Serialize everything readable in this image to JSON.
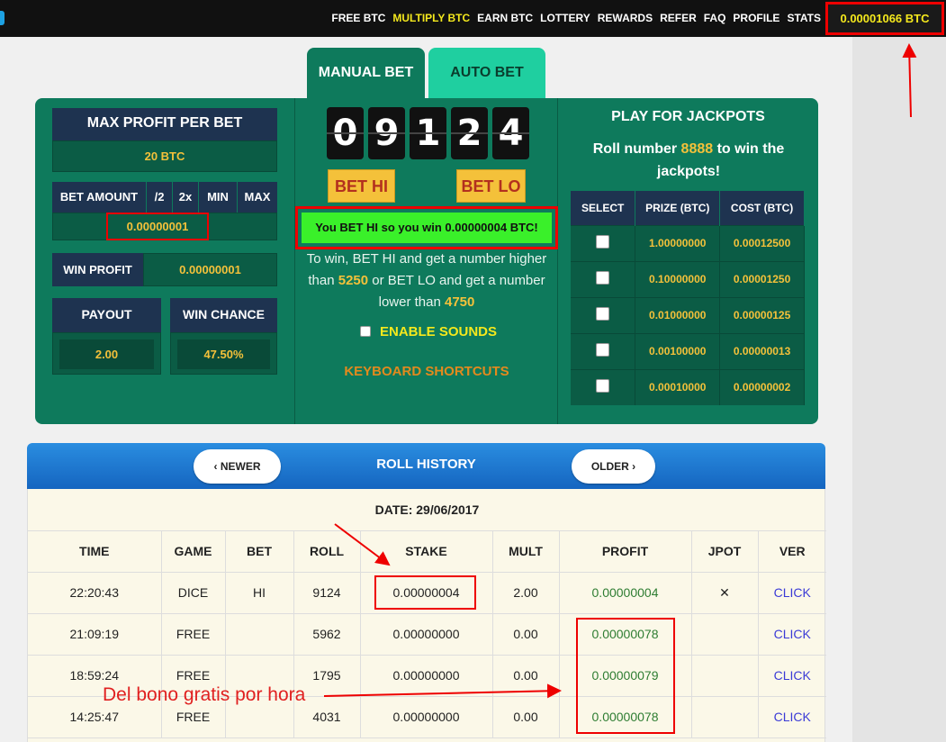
{
  "nav": {
    "items": [
      "FREE BTC",
      "MULTIPLY BTC",
      "EARN BTC",
      "LOTTERY",
      "REWARDS",
      "REFER",
      "FAQ",
      "PROFILE",
      "STATS"
    ],
    "active_index": 1,
    "balance": "0.00001066 BTC"
  },
  "tabs": {
    "manual": "MANUAL BET",
    "auto": "AUTO BET"
  },
  "left": {
    "max_profit_label": "MAX PROFIT PER BET",
    "max_profit_value": "20 BTC",
    "bet_amount_label": "BET AMOUNT",
    "half_label": "/2",
    "double_label": "2x",
    "min_label": "MIN",
    "max_label": "MAX",
    "bet_amount_value": "0.00000001",
    "win_profit_label": "WIN PROFIT",
    "win_profit_value": "0.00000001",
    "payout_label": "PAYOUT",
    "payout_value": "2.00",
    "win_chance_label": "WIN CHANCE",
    "win_chance_value": "47.50%"
  },
  "center": {
    "digits": [
      "0",
      "9",
      "1",
      "2",
      "4"
    ],
    "bet_hi": "BET HI",
    "bet_lo": "BET LO",
    "win_message": "You BET HI so you win 0.00000004 BTC!",
    "rule_a": "To win, BET HI and get a number higher than",
    "rule_hi_num": "5250",
    "rule_b": "or BET LO and get a number lower than",
    "rule_lo_num": "4750",
    "enable_sounds": "ENABLE SOUNDS",
    "keyboard_shortcuts": "KEYBOARD SHORTCUTS"
  },
  "jackpots": {
    "title": "PLAY FOR JACKPOTS",
    "sub_a": "Roll number",
    "sub_num": "8888",
    "sub_b": "to win the jackpots!",
    "headers": [
      "SELECT",
      "PRIZE (BTC)",
      "COST (BTC)"
    ],
    "rows": [
      {
        "prize": "1.00000000",
        "cost": "0.00012500"
      },
      {
        "prize": "0.10000000",
        "cost": "0.00001250"
      },
      {
        "prize": "0.01000000",
        "cost": "0.00000125"
      },
      {
        "prize": "0.00100000",
        "cost": "0.00000013"
      },
      {
        "prize": "0.00010000",
        "cost": "0.00000002"
      }
    ]
  },
  "history": {
    "newer": "NEWER",
    "older": "OLDER",
    "title": "ROLL HISTORY",
    "date": "DATE: 29/06/2017",
    "headers": [
      "TIME",
      "GAME",
      "BET",
      "ROLL",
      "STAKE",
      "MULT",
      "PROFIT",
      "JPOT",
      "VER"
    ],
    "rows": [
      {
        "time": "22:20:43",
        "game": "DICE",
        "bet": "HI",
        "roll": "9124",
        "stake": "0.00000004",
        "mult": "2.00",
        "profit": "0.00000004",
        "jpot": "✕",
        "ver": "CLICK"
      },
      {
        "time": "21:09:19",
        "game": "FREE",
        "bet": "",
        "roll": "5962",
        "stake": "0.00000000",
        "mult": "0.00",
        "profit": "0.00000078",
        "jpot": "",
        "ver": "CLICK"
      },
      {
        "time": "18:59:24",
        "game": "FREE",
        "bet": "",
        "roll": "1795",
        "stake": "0.00000000",
        "mult": "0.00",
        "profit": "0.00000079",
        "jpot": "",
        "ver": "CLICK"
      },
      {
        "time": "14:25:47",
        "game": "FREE",
        "bet": "",
        "roll": "4031",
        "stake": "0.00000000",
        "mult": "0.00",
        "profit": "0.00000078",
        "jpot": "",
        "ver": "CLICK"
      }
    ]
  },
  "annotation": {
    "text": "Del bono gratis por hora"
  },
  "colors": {
    "accent": "#0e7a5c",
    "highlight": "#e00000",
    "gold": "#f4c13a"
  }
}
